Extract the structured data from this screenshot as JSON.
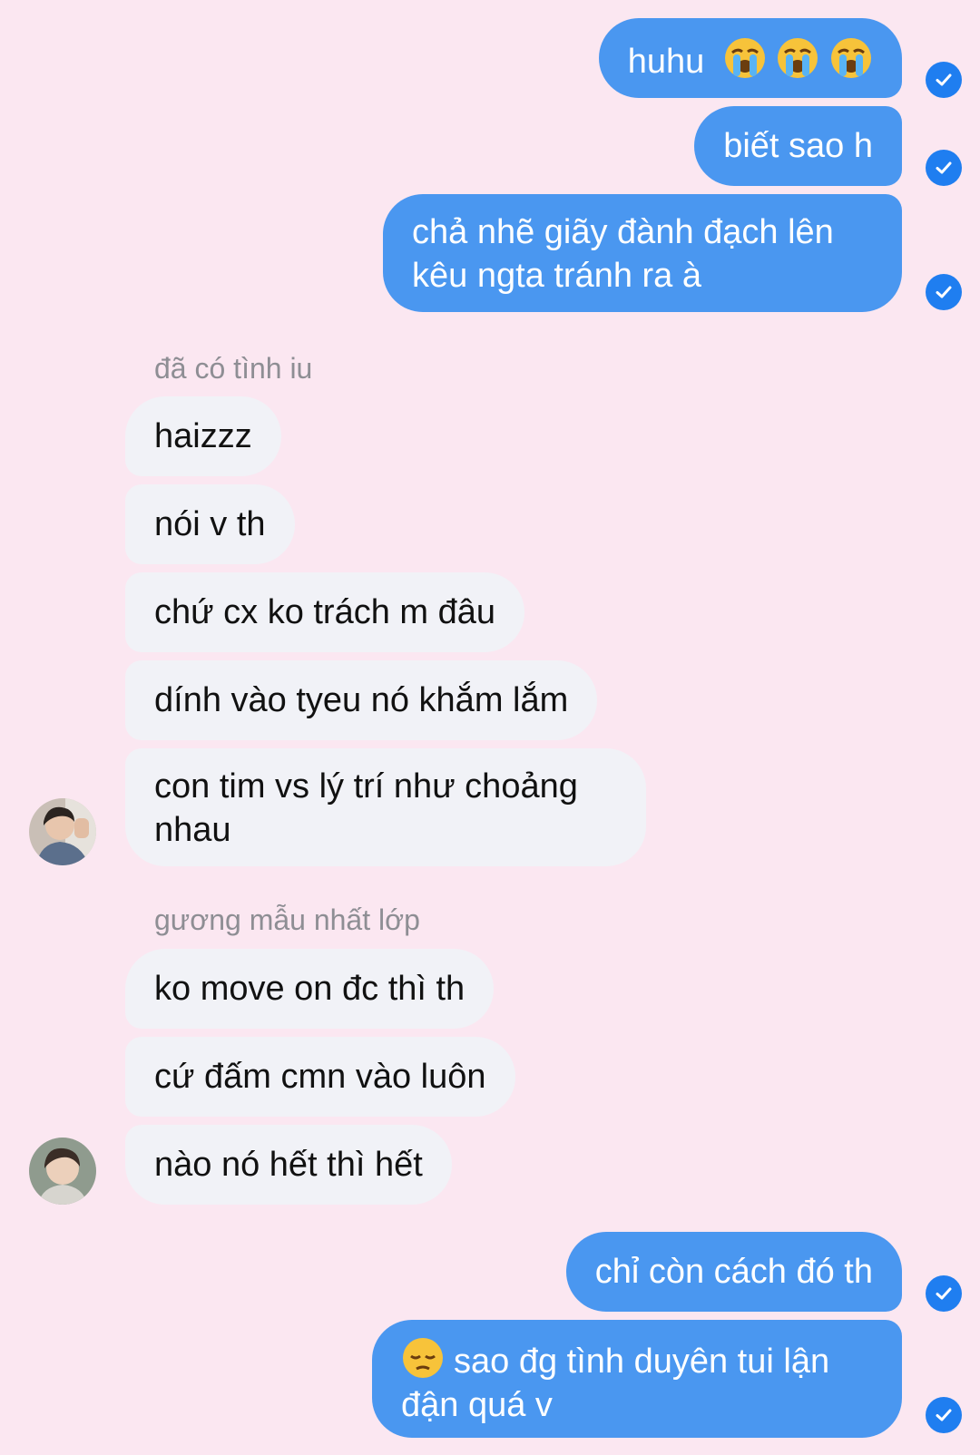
{
  "conversation": {
    "outgoing_top": [
      {
        "text": "huhu",
        "emojis": [
          "crying-face-emoji",
          "crying-face-emoji",
          "crying-face-emoji"
        ]
      },
      {
        "text": "biết sao h"
      },
      {
        "text": "chả nhẽ giãy đành đạch lên kêu ngta tránh ra à"
      }
    ],
    "group1": {
      "sender": "đã có tình iu",
      "messages": [
        "haizzz",
        "nói v th",
        "chứ cx ko trách m đâu",
        "dính vào tyeu nó khắm lắm",
        "con tim vs lý trí như choảng nhau"
      ]
    },
    "group2": {
      "sender": "gương mẫu nhất lớp",
      "messages": [
        "ko move on đc thì th",
        "cứ đấm cmn vào luôn",
        "nào nó hết thì hết"
      ]
    },
    "outgoing_bottom": [
      {
        "text": "chỉ còn cách đó th"
      },
      {
        "text": "sao đg tình duyên tui lận đận quá v",
        "emoji": "pensive-face-emoji"
      }
    ]
  },
  "colors": {
    "background": "#fbe7f1",
    "outgoing_bubble": "#4a97f0",
    "incoming_bubble": "#f1f2f7",
    "read_check": "#1f7ef0",
    "sender_label": "#8e8e94"
  }
}
